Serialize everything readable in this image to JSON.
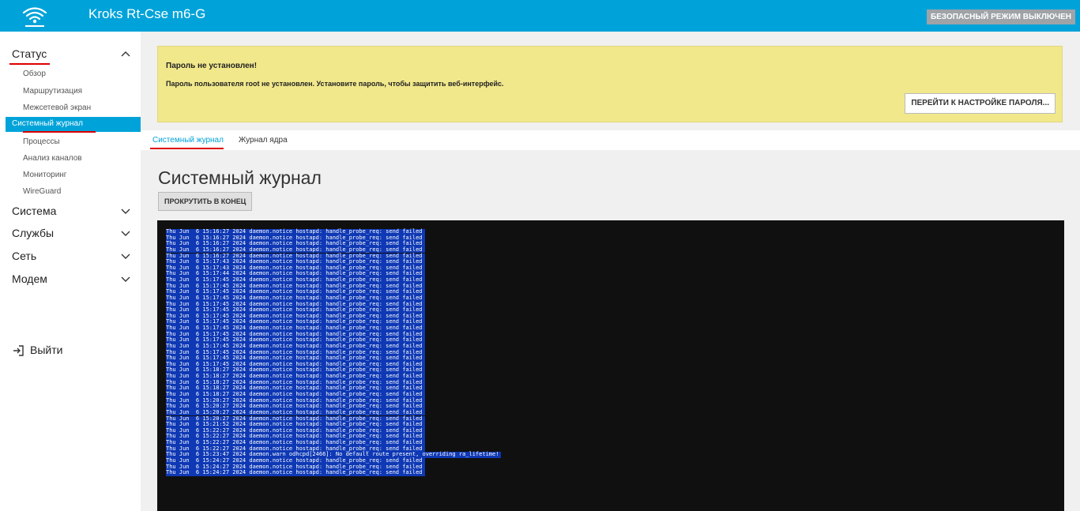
{
  "header": {
    "title": "Kroks Rt-Cse m6-G",
    "safe_mode": "БЕЗОПАСНЫЙ РЕЖИМ ВЫКЛЮЧЕН",
    "logo_icon": "wifi-logo-icon"
  },
  "sidebar": {
    "status": {
      "label": "Статус",
      "items": [
        "Обзор",
        "Маршрутизация",
        "Межсетевой экран",
        "Системный журнал",
        "Процессы",
        "Анализ каналов",
        "Мониторинг",
        "WireGuard"
      ],
      "active": "Системный журнал"
    },
    "sections": [
      "Система",
      "Службы",
      "Сеть",
      "Модем"
    ],
    "logout": "Выйти"
  },
  "alert": {
    "title": "Пароль не установлен!",
    "message": "Пароль пользователя root не установлен. Установите пароль, чтобы защитить веб-интерфейс.",
    "button": "ПЕРЕЙТИ К НАСТРОЙКЕ ПАРОЛЯ..."
  },
  "tabs": [
    {
      "label": "Системный журнал",
      "active": true
    },
    {
      "label": "Журнал ядра",
      "active": false
    }
  ],
  "page": {
    "title": "Системный журнал",
    "scroll_button": "ПРОКРУТИТЬ В КОНЕЦ"
  },
  "log_lines": [
    "Thu Jun  6 15:16:27 2024 daemon.notice hostapd: handle_probe_req: send failed",
    "Thu Jun  6 15:16:27 2024 daemon.notice hostapd: handle_probe_req: send failed",
    "Thu Jun  6 15:16:27 2024 daemon.notice hostapd: handle_probe_req: send failed",
    "Thu Jun  6 15:16:27 2024 daemon.notice hostapd: handle_probe_req: send failed",
    "Thu Jun  6 15:16:27 2024 daemon.notice hostapd: handle_probe_req: send failed",
    "Thu Jun  6 15:17:43 2024 daemon.notice hostapd: handle_probe_req: send failed",
    "Thu Jun  6 15:17:43 2024 daemon.notice hostapd: handle_probe_req: send failed",
    "Thu Jun  6 15:17:44 2024 daemon.notice hostapd: handle_probe_req: send failed",
    "Thu Jun  6 15:17:45 2024 daemon.notice hostapd: handle_probe_req: send failed",
    "Thu Jun  6 15:17:45 2024 daemon.notice hostapd: handle_probe_req: send failed",
    "Thu Jun  6 15:17:45 2024 daemon.notice hostapd: handle_probe_req: send failed",
    "Thu Jun  6 15:17:45 2024 daemon.notice hostapd: handle_probe_req: send failed",
    "Thu Jun  6 15:17:45 2024 daemon.notice hostapd: handle_probe_req: send failed",
    "Thu Jun  6 15:17:45 2024 daemon.notice hostapd: handle_probe_req: send failed",
    "Thu Jun  6 15:17:45 2024 daemon.notice hostapd: handle_probe_req: send failed",
    "Thu Jun  6 15:17:45 2024 daemon.notice hostapd: handle_probe_req: send failed",
    "Thu Jun  6 15:17:45 2024 daemon.notice hostapd: handle_probe_req: send failed",
    "Thu Jun  6 15:17:45 2024 daemon.notice hostapd: handle_probe_req: send failed",
    "Thu Jun  6 15:17:45 2024 daemon.notice hostapd: handle_probe_req: send failed",
    "Thu Jun  6 15:17:45 2024 daemon.notice hostapd: handle_probe_req: send failed",
    "Thu Jun  6 15:17:45 2024 daemon.notice hostapd: handle_probe_req: send failed",
    "Thu Jun  6 15:17:45 2024 daemon.notice hostapd: handle_probe_req: send failed",
    "Thu Jun  6 15:17:45 2024 daemon.notice hostapd: handle_probe_req: send failed",
    "Thu Jun  6 15:18:27 2024 daemon.notice hostapd: handle_probe_req: send failed",
    "Thu Jun  6 15:18:27 2024 daemon.notice hostapd: handle_probe_req: send failed",
    "Thu Jun  6 15:18:27 2024 daemon.notice hostapd: handle_probe_req: send failed",
    "Thu Jun  6 15:18:27 2024 daemon.notice hostapd: handle_probe_req: send failed",
    "Thu Jun  6 15:18:27 2024 daemon.notice hostapd: handle_probe_req: send failed",
    "Thu Jun  6 15:20:27 2024 daemon.notice hostapd: handle_probe_req: send failed",
    "Thu Jun  6 15:20:27 2024 daemon.notice hostapd: handle_probe_req: send failed",
    "Thu Jun  6 15:20:27 2024 daemon.notice hostapd: handle_probe_req: send failed",
    "Thu Jun  6 15:20:27 2024 daemon.notice hostapd: handle_probe_req: send failed",
    "Thu Jun  6 15:21:52 2024 daemon.notice hostapd: handle_probe_req: send failed",
    "Thu Jun  6 15:22:27 2024 daemon.notice hostapd: handle_probe_req: send failed",
    "Thu Jun  6 15:22:27 2024 daemon.notice hostapd: handle_probe_req: send failed",
    "Thu Jun  6 15:22:27 2024 daemon.notice hostapd: handle_probe_req: send failed",
    "Thu Jun  6 15:22:27 2024 daemon.notice hostapd: handle_probe_req: send failed",
    "Thu Jun  6 15:23:47 2024 daemon.warn odhcpd[2466]: No default route present, overriding ra_lifetime!",
    "Thu Jun  6 15:24:27 2024 daemon.notice hostapd: handle_probe_req: send failed",
    "Thu Jun  6 15:24:27 2024 daemon.notice hostapd: handle_probe_req: send failed",
    "Thu Jun  6 15:24:27 2024 daemon.notice hostapd: handle_probe_req: send failed"
  ]
}
